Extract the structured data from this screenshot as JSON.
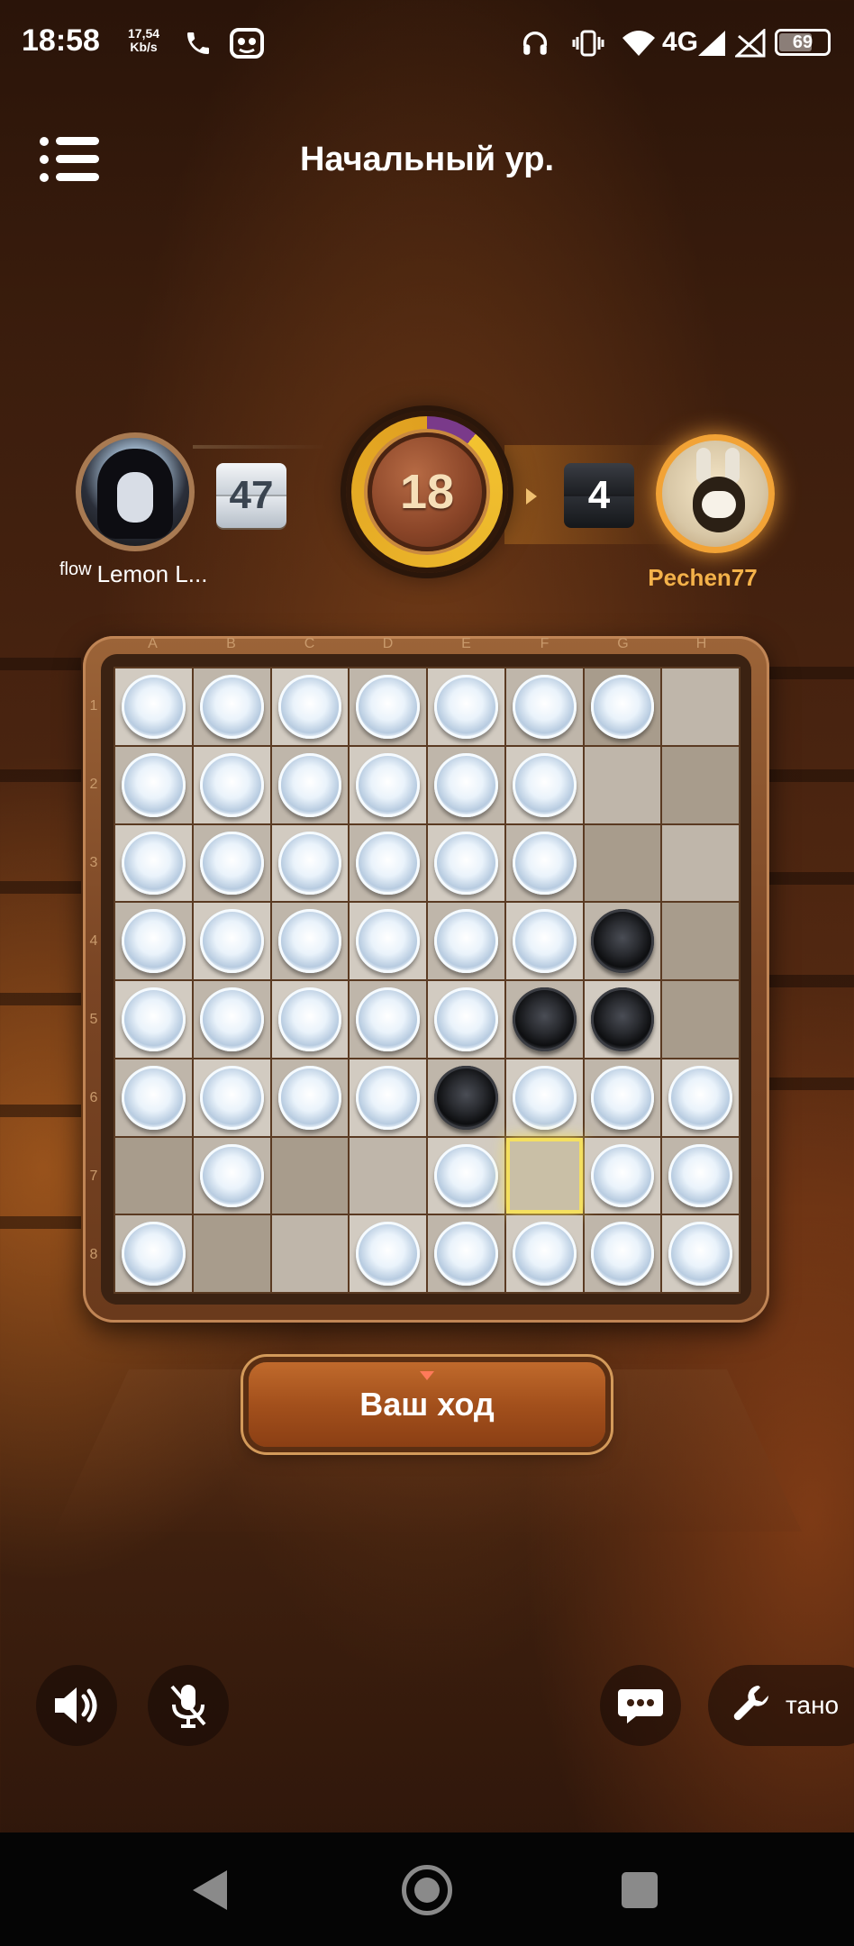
{
  "status_bar": {
    "time": "18:58",
    "speed_value": "17,54",
    "speed_unit": "Kb/s",
    "network": "4G",
    "battery": "69",
    "icons": [
      "phone-icon",
      "app-notification-icon",
      "headphones-icon",
      "vibrate-icon",
      "wifi-icon",
      "signal-icon",
      "no-signal-icon",
      "battery-icon"
    ]
  },
  "header": {
    "title": "Начальный ур.",
    "menu_icon": "menu-list-icon"
  },
  "players": {
    "left": {
      "prefix": "flow",
      "name": "Lemon L...",
      "score": "47",
      "piece_color": "white"
    },
    "right": {
      "name": "Pechen77",
      "score": "4",
      "piece_color": "black",
      "active": true
    }
  },
  "timer": {
    "value": "18"
  },
  "board": {
    "columns": [
      "A",
      "B",
      "C",
      "D",
      "E",
      "F",
      "G",
      "H"
    ],
    "rows": [
      "1",
      "2",
      "3",
      "4",
      "5",
      "6",
      "7",
      "8"
    ],
    "cells": [
      [
        "W",
        "W",
        "W",
        "W",
        "W",
        "W",
        "W",
        "."
      ],
      [
        "W",
        "W",
        "W",
        "W",
        "W",
        "W",
        ".",
        "."
      ],
      [
        "W",
        "W",
        "W",
        "W",
        "W",
        "W",
        ".",
        "."
      ],
      [
        "W",
        "W",
        "W",
        "W",
        "W",
        "W",
        "B",
        "."
      ],
      [
        "W",
        "W",
        "W",
        "W",
        "W",
        "B",
        "B",
        "."
      ],
      [
        "W",
        "W",
        "W",
        "W",
        "B",
        "W",
        "W",
        "W"
      ],
      [
        ".",
        "W",
        ".",
        ".",
        "W",
        ".",
        "W",
        "W"
      ],
      [
        "W",
        ".",
        ".",
        "W",
        "W",
        "W",
        "W",
        "W"
      ]
    ],
    "highlight": "F7"
  },
  "turn_button": {
    "label": "Ваш ход"
  },
  "controls": {
    "sound_icon": "speaker-icon",
    "mic_icon": "mic-off-icon",
    "chat_icon": "chat-icon",
    "tools_icon": "wrench-icon",
    "tools_label": "тано"
  },
  "colors": {
    "accent": "#f4b24a",
    "board_frame": "#7a4524",
    "button": "#a3501c",
    "highlight": "#f4e060"
  }
}
